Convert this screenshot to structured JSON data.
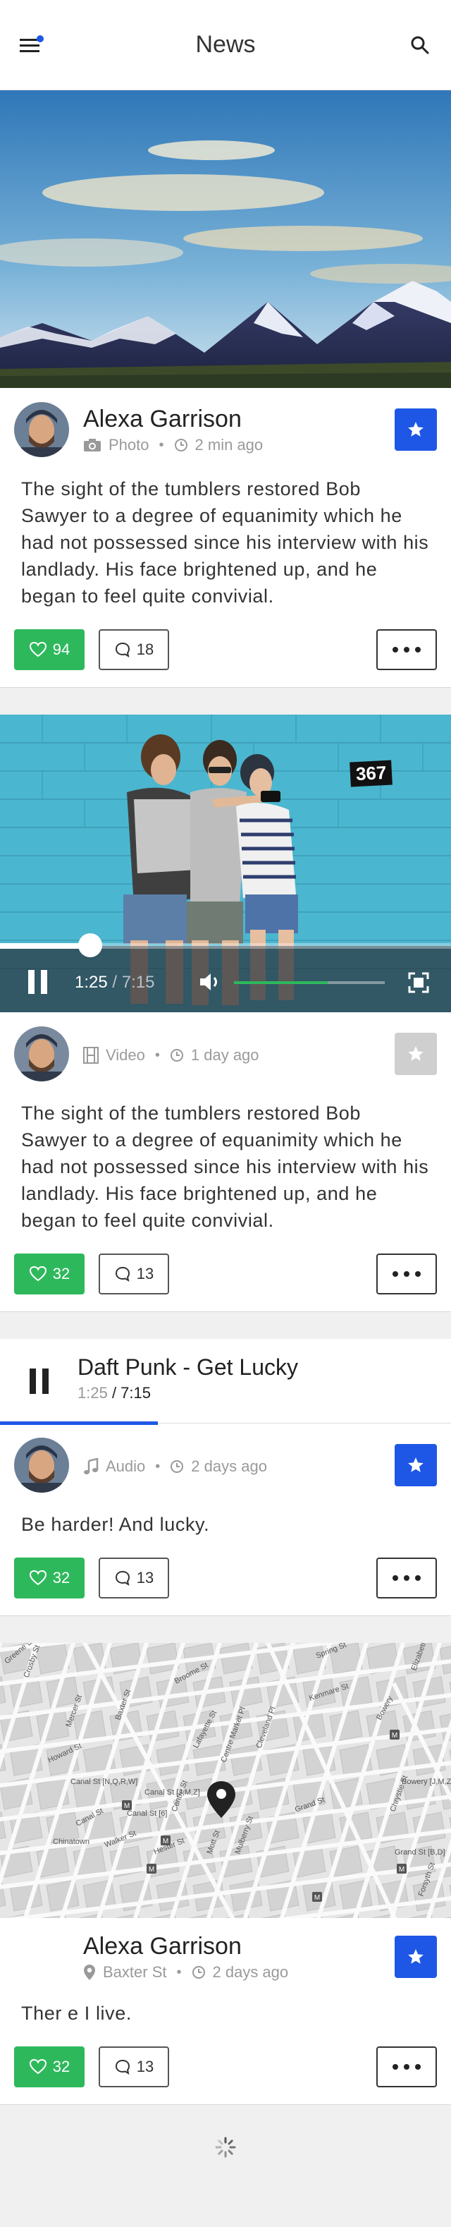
{
  "header": {
    "title": "News"
  },
  "posts": [
    {
      "author": "Alexa Garrison",
      "type": "Photo",
      "time": "2 min ago",
      "text": "The sight of the tumblers restored Bob Sawyer to a degree of equanimity which he had not possessed since his interview with his landlady. His face brightened up, and he began to feel quite convivial.",
      "likes": "94",
      "comments": "18",
      "starred": true
    },
    {
      "type": "Video",
      "time": "1 day ago",
      "text": "The sight of the tumblers restored Bob Sawyer to a degree of equanimity which he had not possessed since his interview with his landlady. His face brightened up, and he began to feel quite convivial.",
      "likes": "32",
      "comments": "13",
      "starred": false,
      "video": {
        "badge": "367",
        "current": "1:25",
        "total": "/ 7:15",
        "progress": 0.2,
        "volume": 0.62
      }
    },
    {
      "type": "Audio",
      "time": "2 days ago",
      "text": "Be harder! And lucky.",
      "likes": "32",
      "comments": "13",
      "starred": true,
      "audio": {
        "title": "Daft Punk - Get Lucky",
        "current": "1:25",
        "total": "/ 7:15",
        "progress": 0.35
      }
    },
    {
      "author": "Alexa Garrison",
      "location": "Baxter St",
      "time": "2 days ago",
      "text": "Ther e I live.",
      "likes": "32",
      "comments": "13",
      "starred": true,
      "map_labels": [
        "Broome St",
        "Spring St",
        "Kenmare St",
        "Bowery",
        "Elizabeth St",
        "Mott St",
        "Mulberry St",
        "Grand St",
        "Lafayette St",
        "Howard St",
        "Canal St",
        "Walker St",
        "Hester St",
        "Centre St",
        "Baxter St",
        "Chinatown",
        "Crosby St",
        "Mercer St",
        "Forsyth St",
        "Chrystie St",
        "Canal St [J,M,Z]",
        "Canal St [6]",
        "Canal St [N,Q,R,W]",
        "Bowery [J,M,Z]",
        "Grand St [B,D]",
        "Cleveland Pl",
        "Centre Market Pl",
        "Greene St"
      ]
    }
  ],
  "colors": {
    "accent": "#1e57e6",
    "like": "#2eb85c"
  },
  "icons": [
    "menu-icon",
    "search-icon",
    "camera-icon",
    "clock-icon",
    "film-icon",
    "music-icon",
    "location-pin-icon",
    "star-icon",
    "heart-icon",
    "comment-icon",
    "more-icon",
    "pause-icon",
    "volume-icon",
    "fullscreen-icon",
    "spinner-icon"
  ]
}
